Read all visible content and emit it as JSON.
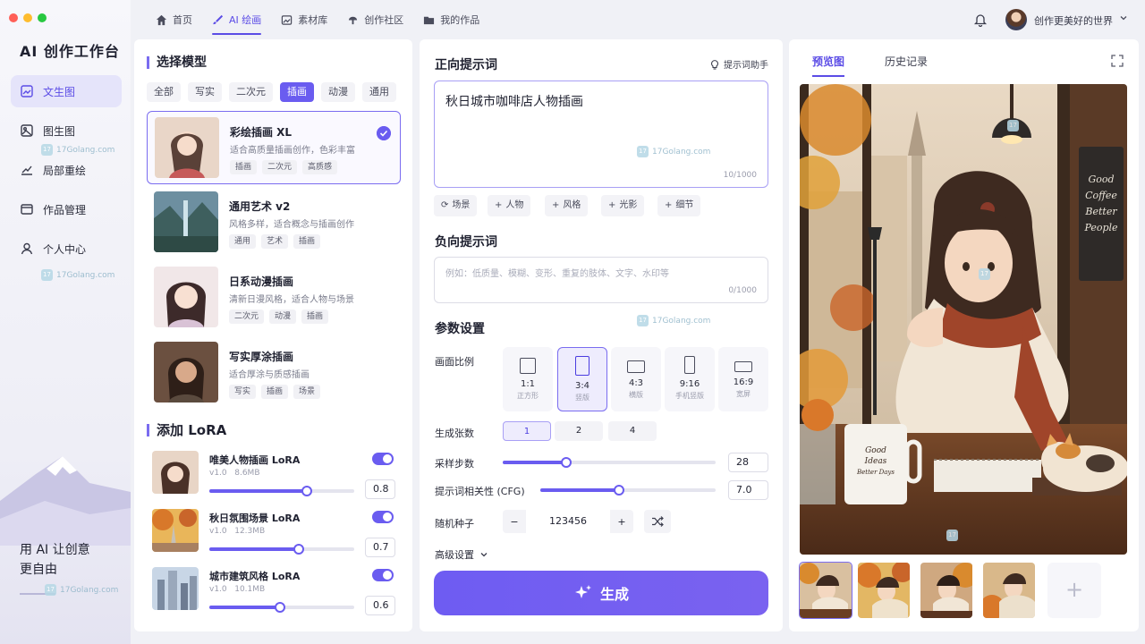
{
  "app": {
    "brand": "AI 创作工作台",
    "slogan1": "用 AI 让创意",
    "slogan2": "更自由",
    "watermark": "17Golang.com"
  },
  "window_controls": {
    "close_color": "#ff5f57",
    "minimize_color": "#febc2e",
    "maximize_color": "#28c840"
  },
  "sidebar": {
    "items": [
      {
        "label": "文生图",
        "icon": "image-icon"
      },
      {
        "label": "图生图",
        "icon": "picture-icon"
      },
      {
        "label": "局部重绘",
        "icon": "trend-icon"
      },
      {
        "label": "作品管理",
        "icon": "folder-icon"
      },
      {
        "label": "个人中心",
        "icon": "user-icon"
      }
    ],
    "active": 0
  },
  "topbar": {
    "tabs": [
      {
        "label": "首页"
      },
      {
        "label": "AI 绘画"
      },
      {
        "label": "素材库"
      },
      {
        "label": "创作社区"
      },
      {
        "label": "我的作品"
      }
    ],
    "active": 1,
    "user_name": "创作更美好的世界"
  },
  "models": {
    "title": "选择模型",
    "filters": [
      "全部",
      "写实",
      "二次元",
      "插画",
      "动漫",
      "通用"
    ],
    "active_filter": 3,
    "list": [
      {
        "name": "彩绘插画 XL",
        "desc": "适合高质量插画创作，色彩丰富",
        "tags": [
          "插画",
          "二次元",
          "高质感"
        ]
      },
      {
        "name": "通用艺术 v2",
        "desc": "风格多样，适合概念与插画创作",
        "tags": [
          "通用",
          "艺术",
          "插画"
        ]
      },
      {
        "name": "日系动漫插画",
        "desc": "清新日漫风格，适合人物与场景",
        "tags": [
          "二次元",
          "动漫",
          "插画"
        ]
      },
      {
        "name": "写实厚涂插画",
        "desc": "适合厚涂与质感插画",
        "tags": [
          "写实",
          "插画",
          "场景"
        ]
      }
    ],
    "selected": 0
  },
  "lora": {
    "title": "添加 LoRA",
    "items": [
      {
        "name": "唯美人物插画 LoRA",
        "version": "v1.0",
        "size": "8.6MB",
        "weight": "0.8",
        "enabled": true
      },
      {
        "name": "秋日氛围场景 LoRA",
        "version": "v1.0",
        "size": "12.3MB",
        "weight": "0.7",
        "enabled": true
      },
      {
        "name": "城市建筑风格 LoRA",
        "version": "v1.0",
        "size": "10.1MB",
        "weight": "0.6",
        "enabled": true
      }
    ]
  },
  "prompt": {
    "title": "正向提示词",
    "helper": "提示词助手",
    "value": "秋日城市咖啡店人物插画",
    "count": "10/1000",
    "quick": [
      "场景",
      "人物",
      "风格",
      "光影",
      "细节"
    ]
  },
  "negative": {
    "title": "负向提示词",
    "placeholder": "例如：低质量、模糊、变形、重复的肢体、文字、水印等",
    "count": "0/1000"
  },
  "params": {
    "title": "参数设置",
    "ratio_label": "画面比例",
    "ratios": [
      {
        "value": "1:1",
        "name": "正方形"
      },
      {
        "value": "3:4",
        "name": "竖版"
      },
      {
        "value": "4:3",
        "name": "横版"
      },
      {
        "value": "9:16",
        "name": "手机竖版"
      },
      {
        "value": "16:9",
        "name": "宽屏"
      }
    ],
    "active_ratio": 1,
    "count_label": "生成张数",
    "counts": [
      "1",
      "2",
      "4"
    ],
    "active_count": 0,
    "steps_label": "采样步数",
    "steps": "28",
    "steps_fraction": 0.3,
    "cfg_label": "提示词相关性 (CFG)",
    "cfg": "7.0",
    "cfg_fraction": 0.45,
    "seed_label": "随机种子",
    "seed": "123456",
    "minus": "−",
    "plus": "+",
    "advanced": "高级设置"
  },
  "generate": {
    "label": "生成"
  },
  "preview": {
    "tabs": [
      "预览图",
      "历史记录"
    ],
    "active": 0,
    "cup_text": "Good Ideas Better Days",
    "board_text": "Good Coffee Better People"
  },
  "colors": {
    "accent": "#6a5cf0",
    "accent_dark": "#5b4ce6"
  }
}
